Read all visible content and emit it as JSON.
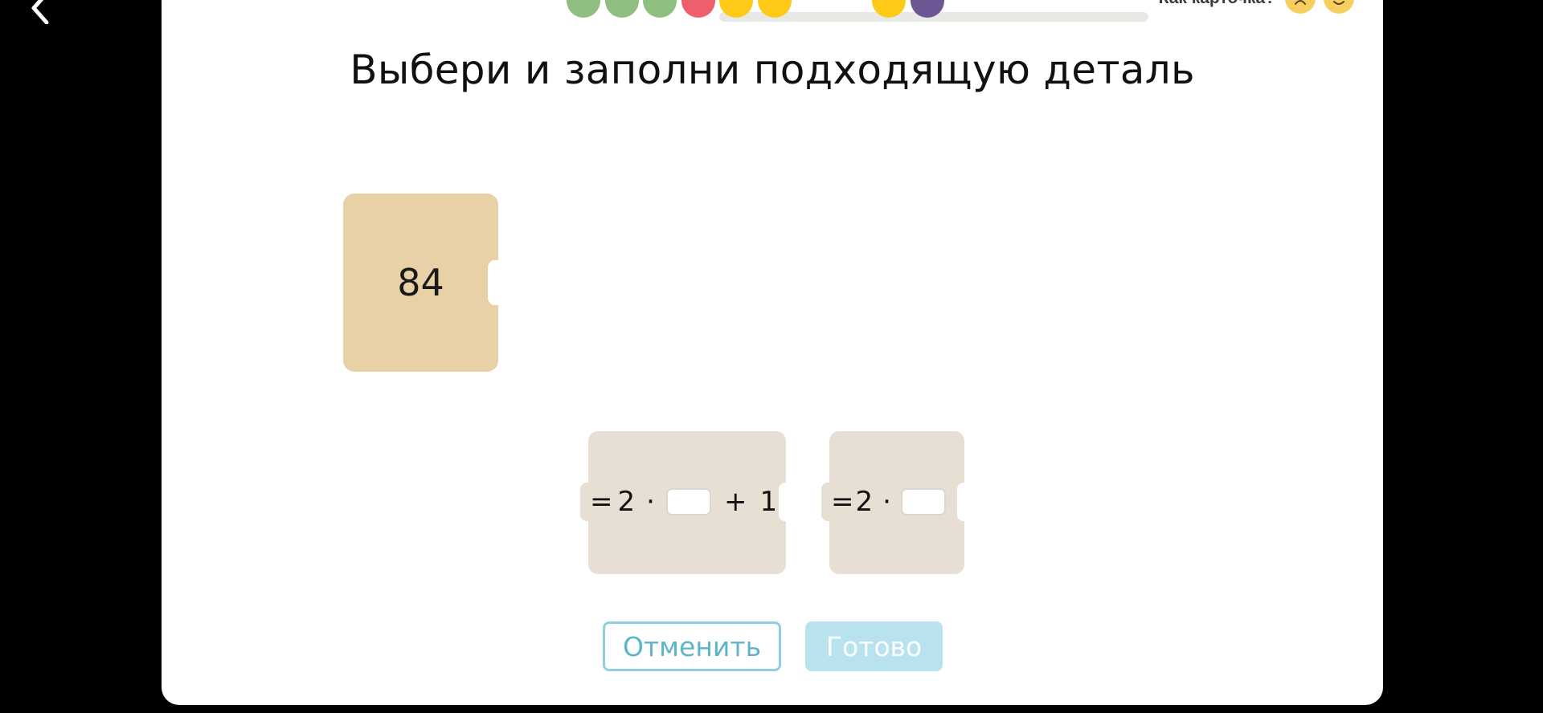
{
  "progress": {
    "dots": [
      "#8fbf7f",
      "#8fbf7f",
      "#8fbf7f",
      "#ee5f6b",
      "#ffc917",
      "#ffc917",
      "",
      "",
      "#ffc917",
      "#6e5594"
    ]
  },
  "feedback": {
    "label": "Как карточка?",
    "icons": [
      "sad-face-icon",
      "smile-face-icon"
    ]
  },
  "title": "Выбери и заполни подходящую деталь",
  "main_piece": {
    "value": "84"
  },
  "options": [
    {
      "eq": "=",
      "two": "2",
      "dot": "·",
      "plus": "+",
      "one": "1"
    },
    {
      "eq": "=",
      "two": "2",
      "dot": "·"
    }
  ],
  "buttons": {
    "cancel": "Отменить",
    "done": "Готово"
  },
  "colors": {
    "accent": "#5db4cb",
    "piece": "#e9d1a7",
    "option": "#e7dfd4"
  }
}
